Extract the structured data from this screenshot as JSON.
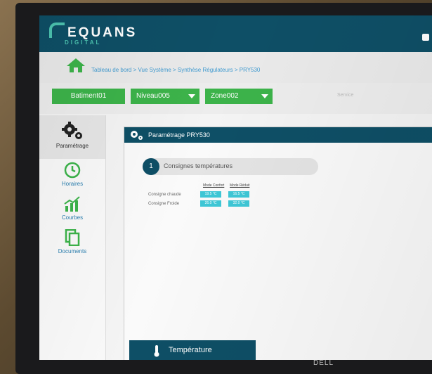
{
  "app": {
    "logo_text": "EQUANS",
    "logo_sub": "DIGITAL"
  },
  "breadcrumb": "Tableau de bord > Vue Système > Synthèse Régulateurs > PRY530",
  "filters": {
    "batiment": "Batiment01",
    "niveau": "Niveau005",
    "zone": "Zone002",
    "service": "Service"
  },
  "sidebar": {
    "items": [
      {
        "label": "Paramétrage",
        "icon": "gears-icon"
      },
      {
        "label": "Horaires",
        "icon": "clock-icon"
      },
      {
        "label": "Courbes",
        "icon": "chart-icon"
      },
      {
        "label": "Documents",
        "icon": "documents-icon"
      }
    ]
  },
  "panel": {
    "title": "Paramétrage PRY530",
    "section_number": "1",
    "section_label": "Consignes températures",
    "columns": [
      "Mode Confort",
      "Mode Réduit"
    ],
    "rows": [
      {
        "label": "Consigne chaude",
        "values": [
          "19.5 °C",
          "16.5 °C"
        ]
      },
      {
        "label": "Consigne Froide",
        "values": [
          "26.0 °C",
          "32.0 °C"
        ]
      }
    ]
  },
  "bottom_tab": {
    "label": "Température"
  },
  "monitor": {
    "brand": "DELL"
  },
  "colors": {
    "header": "#0e4f66",
    "green": "#3cb34a",
    "accent": "#4cc3b0",
    "value": "#3ec7d6"
  }
}
